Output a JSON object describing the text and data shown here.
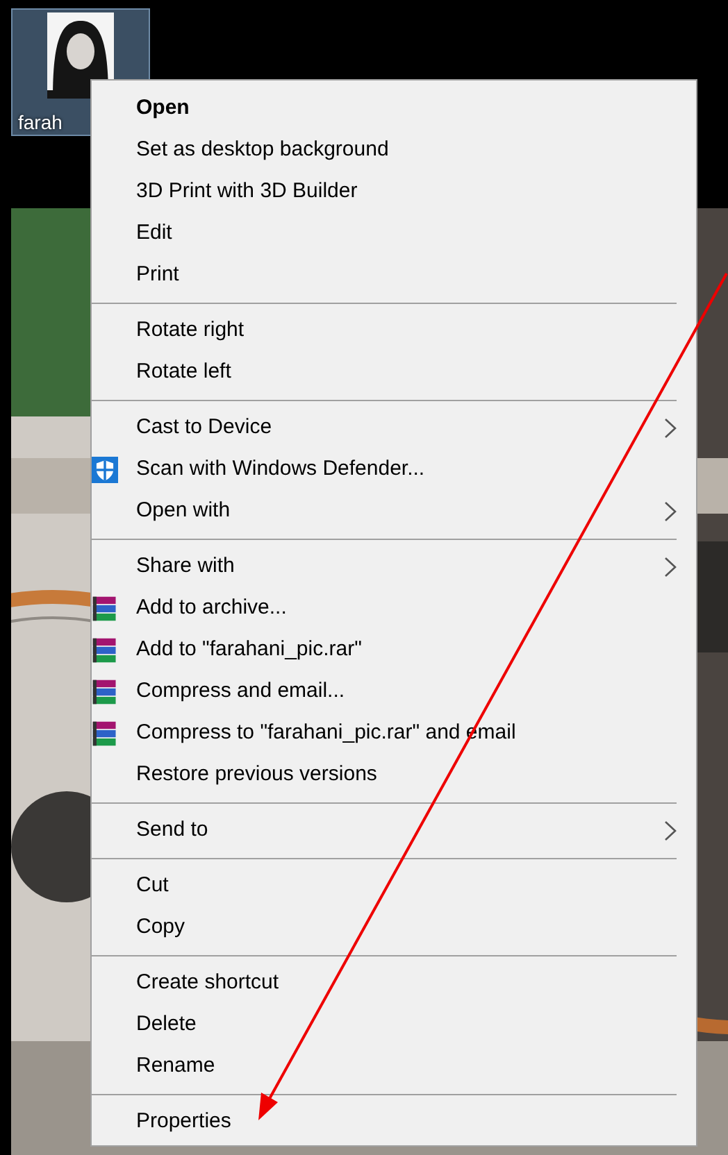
{
  "desktop_icon": {
    "label": "farah",
    "selected": true,
    "kind": "picture"
  },
  "context_menu": {
    "items": [
      {
        "kind": "default",
        "label": "Open"
      },
      {
        "kind": "plain",
        "label": "Set as desktop background"
      },
      {
        "kind": "plain",
        "label": "3D Print with 3D Builder"
      },
      {
        "kind": "plain",
        "label": "Edit"
      },
      {
        "kind": "plain",
        "label": "Print"
      },
      {
        "kind": "separator"
      },
      {
        "kind": "plain",
        "label": "Rotate right"
      },
      {
        "kind": "plain",
        "label": "Rotate left"
      },
      {
        "kind": "separator"
      },
      {
        "kind": "submenu",
        "label": "Cast to Device"
      },
      {
        "kind": "shield",
        "label": "Scan with Windows Defender..."
      },
      {
        "kind": "submenu",
        "label": "Open with"
      },
      {
        "kind": "separator"
      },
      {
        "kind": "submenu",
        "label": "Share with"
      },
      {
        "kind": "archive",
        "label": "Add to archive..."
      },
      {
        "kind": "archive",
        "label": "Add to \"farahani_pic.rar\""
      },
      {
        "kind": "archive",
        "label": "Compress and email..."
      },
      {
        "kind": "archive",
        "label": "Compress to \"farahani_pic.rar\" and email"
      },
      {
        "kind": "plain",
        "label": "Restore previous versions"
      },
      {
        "kind": "separator"
      },
      {
        "kind": "submenu",
        "label": "Send to"
      },
      {
        "kind": "separator"
      },
      {
        "kind": "plain",
        "label": "Cut"
      },
      {
        "kind": "plain",
        "label": "Copy"
      },
      {
        "kind": "separator"
      },
      {
        "kind": "plain",
        "label": "Create shortcut"
      },
      {
        "kind": "plain",
        "label": "Delete"
      },
      {
        "kind": "plain",
        "label": "Rename"
      },
      {
        "kind": "separator"
      },
      {
        "kind": "plain",
        "label": "Properties"
      }
    ]
  }
}
